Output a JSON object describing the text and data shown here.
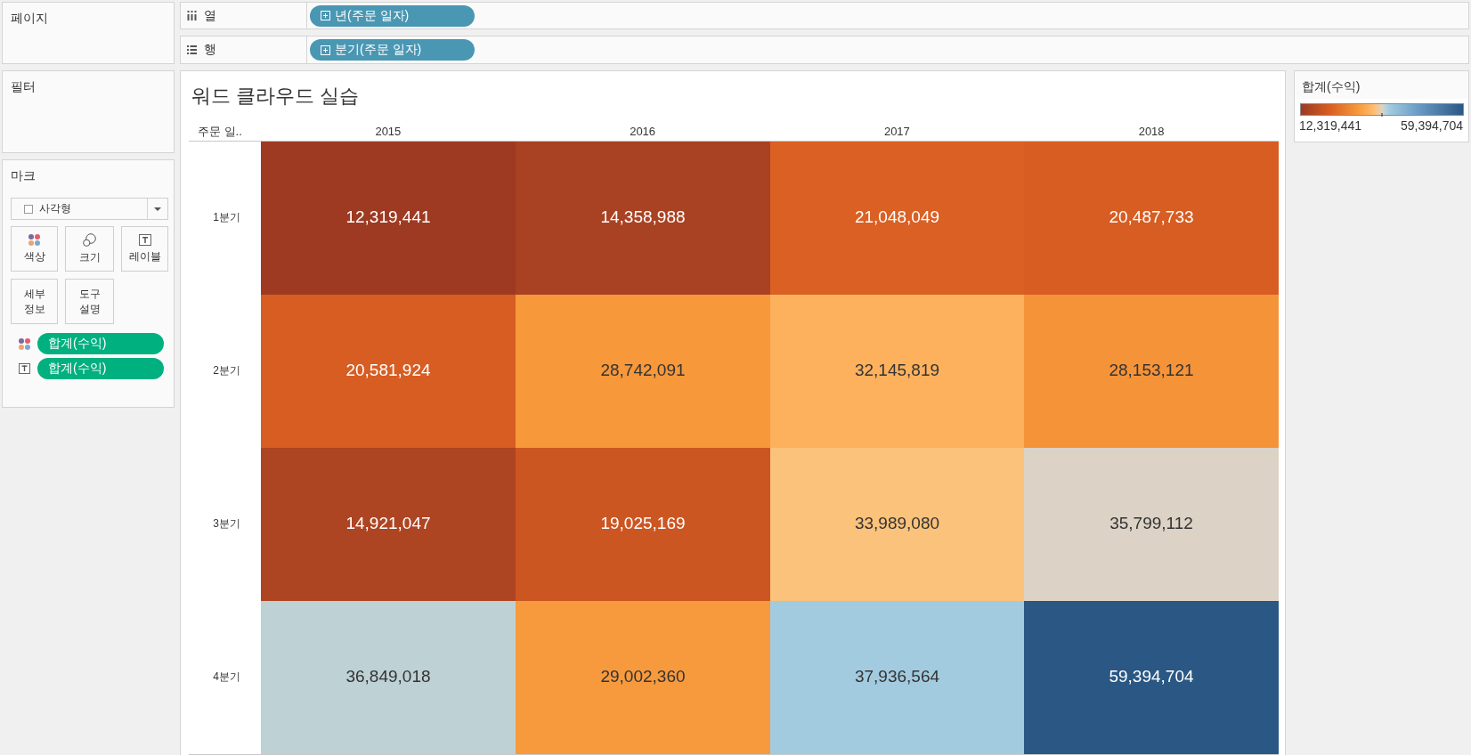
{
  "sidebar": {
    "pages": {
      "title": "페이지"
    },
    "filters": {
      "title": "필터"
    },
    "marks": {
      "title": "마크",
      "mark_type": {
        "kind": "square",
        "label": "사각형"
      },
      "cards": [
        {
          "kind": "color",
          "label": "색상"
        },
        {
          "kind": "size",
          "label": "크기"
        },
        {
          "kind": "label",
          "label": "레이블"
        },
        {
          "kind": "detail",
          "label": "세부 정보"
        },
        {
          "kind": "tooltip",
          "label": "도구 설명"
        }
      ],
      "fields": [
        {
          "kind": "color",
          "label": "합계(수익)"
        },
        {
          "kind": "label",
          "label": "합계(수익)"
        }
      ]
    }
  },
  "shelves": [
    {
      "kind": "columns",
      "label": "열",
      "pill": "년(주문 일자)"
    },
    {
      "kind": "rows",
      "label": "행",
      "pill": "분기(주문 일자)"
    }
  ],
  "view": {
    "chart_data": [
      {
        "type": "heatmap",
        "title": "워드 클라우드 실습",
        "ylabel": "주문 일..",
        "categories": [
          "2015",
          "2016",
          "2017",
          "2018"
        ],
        "y_categories": [
          "1분기",
          "2분기",
          "3분기",
          "4분기"
        ],
        "cells": [
          [
            12319441,
            14358988,
            21048049,
            20487733
          ],
          [
            20581924,
            28742091,
            32145819,
            28153121
          ],
          [
            14921047,
            19025169,
            33989080,
            35799112
          ],
          [
            36849018,
            29002360,
            37936564,
            59394704
          ]
        ],
        "cell_labels": [
          [
            "12,319,441",
            "14,358,988",
            "21,048,049",
            "20,487,733"
          ],
          [
            "20,581,924",
            "28,742,091",
            "32,145,819",
            "28,153,121"
          ],
          [
            "14,921,047",
            "19,025,169",
            "33,989,080",
            "35,799,112"
          ],
          [
            "36,849,018",
            "29,002,360",
            "37,936,564",
            "59,394,704"
          ]
        ],
        "data_labels": true
      }
    ]
  },
  "legend": {
    "title": "합계(수익)",
    "min_label": "12,319,441",
    "max_label": "59,394,704"
  }
}
